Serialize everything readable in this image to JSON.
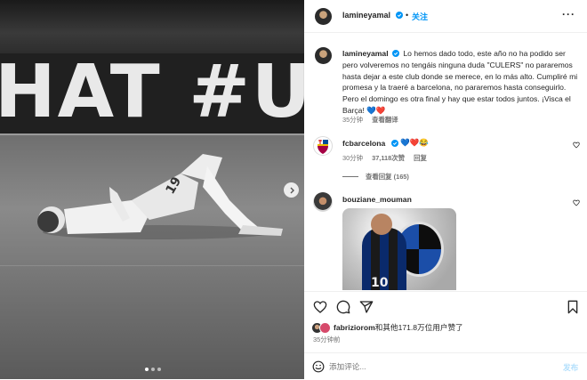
{
  "media": {
    "banner_text": "HAT #U",
    "carousel_dot_count": 3,
    "carousel_active_index": 0
  },
  "header": {
    "username": "lamineyamal",
    "follow_label": "关注",
    "more_label": "···"
  },
  "caption": {
    "username": "lamineyamal",
    "text": "Lo hemos dado todo, este año no ha podido ser pero volveremos no tengáis ninguna duda \"CULERS\" no pararemos hasta dejar a este club donde se merece, en lo más alto. Cumpliré mi promesa y la traeré a barcelona, no pararemos hasta conseguirlo. Pero el domingo es otra final y hay que estar todos juntos. ¡Visca el Barça! 💙❤️",
    "time": "35分钟",
    "translate_label": "查看翻译"
  },
  "comments": [
    {
      "username": "fcbarcelona",
      "text": "💙❤️😂",
      "time": "30分钟",
      "likes": "37,118次赞",
      "reply_label": "回复",
      "view_replies": "查看回复 (165)"
    },
    {
      "username": "bouziane_mouman",
      "gif_number": "10"
    }
  ],
  "footer": {
    "liked_by_user": "fabriziorom",
    "liked_by_text": "和其他171.8万位用户赞了",
    "posted_time": "35分钟前",
    "comment_placeholder": "添加评论...",
    "post_label": "发布"
  },
  "colors": {
    "accent": "#0095f6",
    "text": "#262626",
    "muted": "#737373",
    "post_disabled": "#b2dffc"
  },
  "icons": [
    "verified-badge-icon",
    "more-options-icon",
    "heart-icon",
    "comment-icon",
    "share-icon",
    "bookmark-icon",
    "emoji-icon",
    "next-arrow-icon"
  ]
}
